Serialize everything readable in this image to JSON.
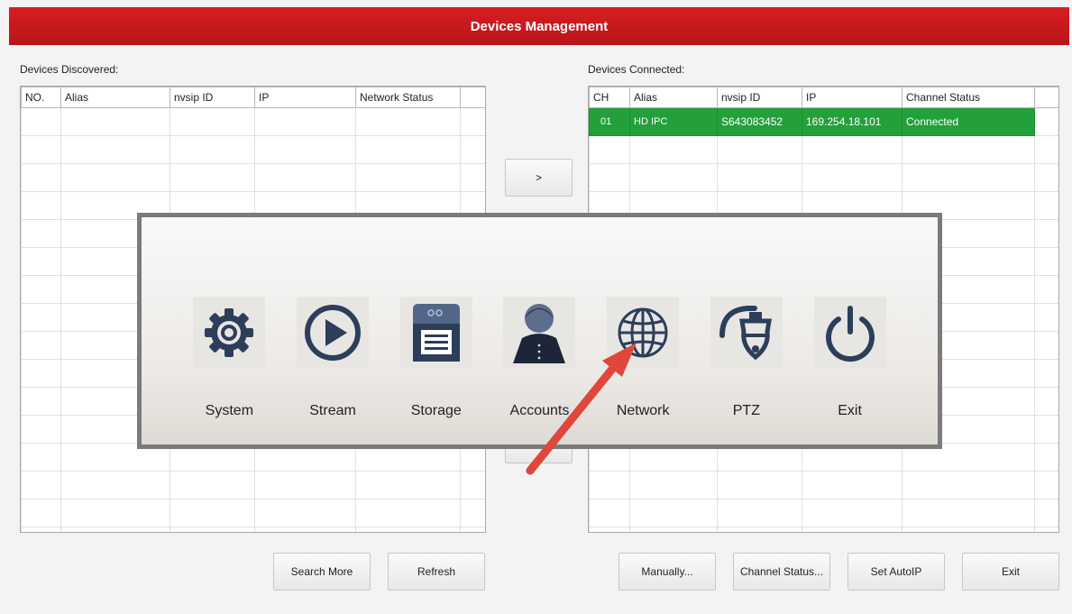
{
  "title": "Devices Management",
  "discovered": {
    "label": "Devices Discovered:",
    "columns": [
      "NO.",
      "Alias",
      "nvsip ID",
      "IP",
      "Network Status",
      ""
    ]
  },
  "connected": {
    "label": "Devices Connected:",
    "columns": [
      "CH",
      "Alias",
      "nvsip ID",
      "IP",
      "Channel Status",
      ""
    ],
    "rows": [
      {
        "ch": "01",
        "alias": "HD IPC",
        "nvsip": "S643083452",
        "ip": "169.254.18.101",
        "status": "Connected"
      }
    ]
  },
  "transfer": {
    "add_label": ">"
  },
  "buttons": {
    "search_more": "Search More",
    "refresh": "Refresh",
    "manually": "Manually...",
    "channel_status": "Channel Status...",
    "set_autoip": "Set AutoIP",
    "exit": "Exit"
  },
  "menu": [
    {
      "label": "System",
      "icon": "gear-icon"
    },
    {
      "label": "Stream",
      "icon": "play-icon"
    },
    {
      "label": "Storage",
      "icon": "sd-card-icon"
    },
    {
      "label": "Accounts",
      "icon": "user-icon"
    },
    {
      "label": "Network",
      "icon": "globe-icon"
    },
    {
      "label": "PTZ",
      "icon": "ptz-camera-icon"
    },
    {
      "label": "Exit",
      "icon": "power-icon"
    }
  ],
  "colors": {
    "titlebar": "#c9191f",
    "connected_row": "#23a03b",
    "arrow": "#e0463a"
  }
}
